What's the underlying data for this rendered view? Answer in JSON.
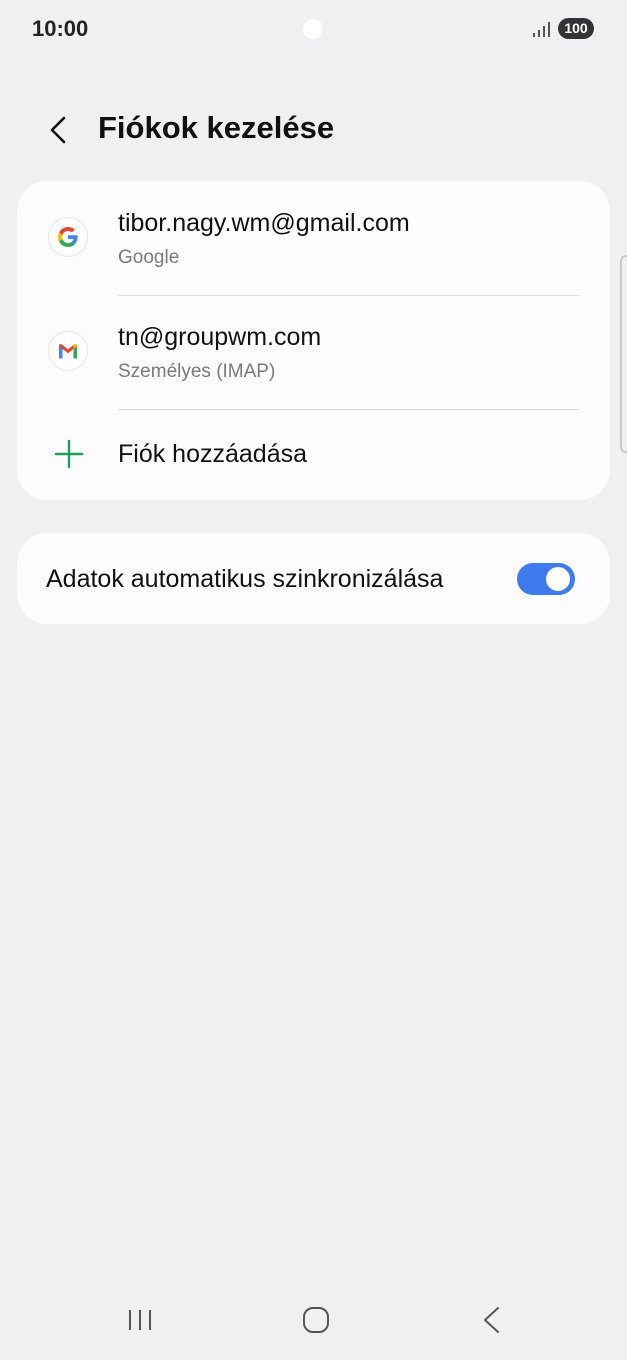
{
  "status_bar": {
    "time": "10:00",
    "battery": "100",
    "signal_icon": "signal-bars-icon"
  },
  "header": {
    "title": "Fiókok kezelése",
    "back_icon": "chevron-left-icon"
  },
  "accounts": [
    {
      "email": "tibor.nagy.wm@gmail.com",
      "type": "Google",
      "icon": "google-icon"
    },
    {
      "email": "tn@groupwm.com",
      "type": "Személyes (IMAP)",
      "icon": "gmail-icon"
    }
  ],
  "add_account": {
    "label": "Fiók hozzáadása",
    "icon": "plus-icon",
    "icon_color": "#1aa058"
  },
  "sync": {
    "label": "Adatok automatikus szinkronizálása",
    "enabled": true,
    "accent_color": "#3e7bf0"
  },
  "nav": {
    "recents_icon": "recents-icon",
    "home_icon": "home-icon",
    "back_icon": "back-icon"
  }
}
